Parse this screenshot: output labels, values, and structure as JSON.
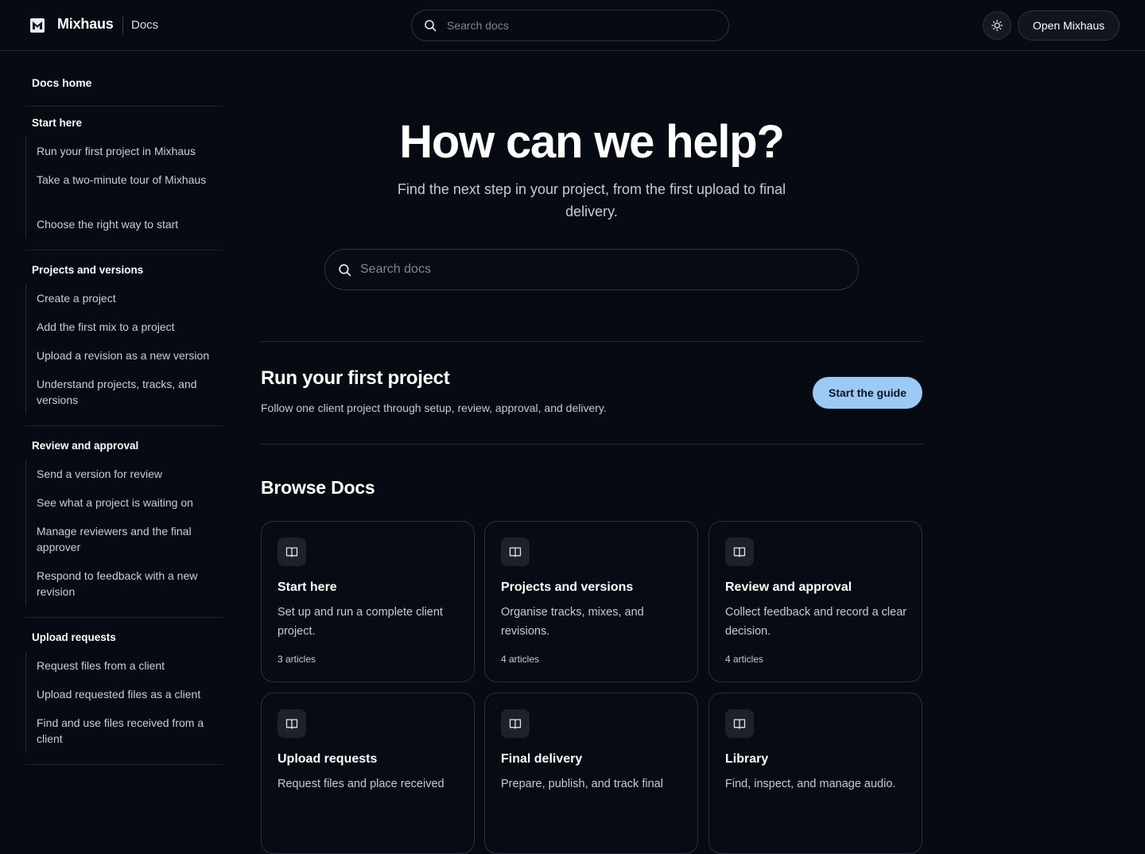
{
  "header": {
    "brand": "Mixhaus",
    "section": "Docs",
    "search_placeholder": "Search docs",
    "open_button": "Open Mixhaus"
  },
  "sidebar": {
    "home": "Docs home",
    "sections": [
      {
        "title": "Start here",
        "items": [
          "Run your first project in Mixhaus",
          "Take a two-minute tour of Mixhaus",
          "Choose the right way to start"
        ]
      },
      {
        "title": "Projects and versions",
        "items": [
          "Create a project",
          "Add the first mix to a project",
          "Upload a revision as a new version",
          "Understand projects, tracks, and versions"
        ]
      },
      {
        "title": "Review and approval",
        "items": [
          "Send a version for review",
          "See what a project is waiting on",
          "Manage reviewers and the final approver",
          "Respond to feedback with a new revision"
        ]
      },
      {
        "title": "Upload requests",
        "items": [
          "Request files from a client",
          "Upload requested files as a client",
          "Find and use files received from a client"
        ]
      }
    ]
  },
  "hero": {
    "title": "How can we help?",
    "subtitle": "Find the next step in your project, from the first upload to final delivery.",
    "search_placeholder": "Search docs"
  },
  "guide": {
    "title": "Run your first project",
    "description": "Follow one client project through setup, review, approval, and delivery.",
    "button": "Start the guide"
  },
  "browse": {
    "title": "Browse Docs",
    "cards": [
      {
        "title": "Start here",
        "description": "Set up and run a complete client project.",
        "count": "3 articles",
        "icon": "book-icon"
      },
      {
        "title": "Projects and versions",
        "description": "Organise tracks, mixes, and revisions.",
        "count": "4 articles",
        "icon": "book-icon"
      },
      {
        "title": "Review and approval",
        "description": "Collect feedback and record a clear decision.",
        "count": "4 articles",
        "icon": "book-icon"
      },
      {
        "title": "Upload requests",
        "description": "Request files and place received",
        "icon": "book-icon"
      },
      {
        "title": "Final delivery",
        "description": "Prepare, publish, and track final",
        "icon": "book-icon"
      },
      {
        "title": "Library",
        "description": "Find, inspect, and manage audio.",
        "icon": "book-icon"
      }
    ]
  },
  "colors": {
    "background": "#060a12",
    "accent_button": "#9cc9f5",
    "border": "#2a303b"
  }
}
